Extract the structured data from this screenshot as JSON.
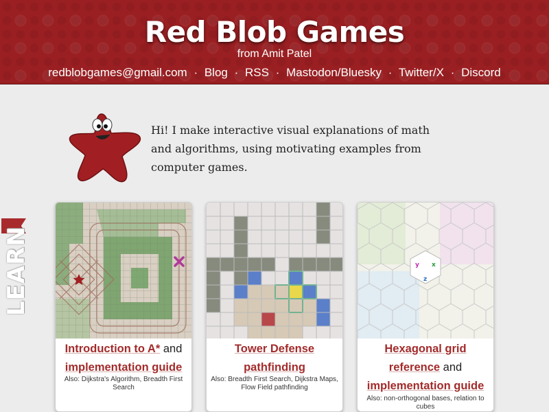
{
  "header": {
    "title": "Red Blob Games",
    "subtitle": "from Amit Patel",
    "nav": [
      "redblobgames@gmail.com",
      "Blog",
      "RSS",
      "Mastodon/Bluesky",
      "Twitter/X",
      "Discord"
    ],
    "separator": "·"
  },
  "intro": {
    "text": "Hi! I make interactive visual explanations of math and algorithms, using motivating examples from computer games."
  },
  "learn_tab": {
    "label": "LEARN"
  },
  "cards": [
    {
      "title_link": "Introduction to A*",
      "title_mid": " and ",
      "title_link2": "implementation guide",
      "also": "Also: Dijkstra's Algorithm, Breadth First Search"
    },
    {
      "title_link": "Tower Defense pathfinding",
      "also": "Also: Breadth First Search, Dijkstra Maps, Flow Field pathfinding"
    },
    {
      "title_link": "Hexagonal grid reference",
      "title_mid": " and ",
      "title_link2": "implementation guide",
      "also": "Also: non-orthogonal bases, relation to cubes"
    }
  ],
  "thumbnail_labels": {
    "hex_axes": [
      "y",
      "x",
      "z"
    ]
  },
  "colors": {
    "header_red": "#9a1f22",
    "link_red": "#a32b2b",
    "page_bg": "#ececec"
  }
}
